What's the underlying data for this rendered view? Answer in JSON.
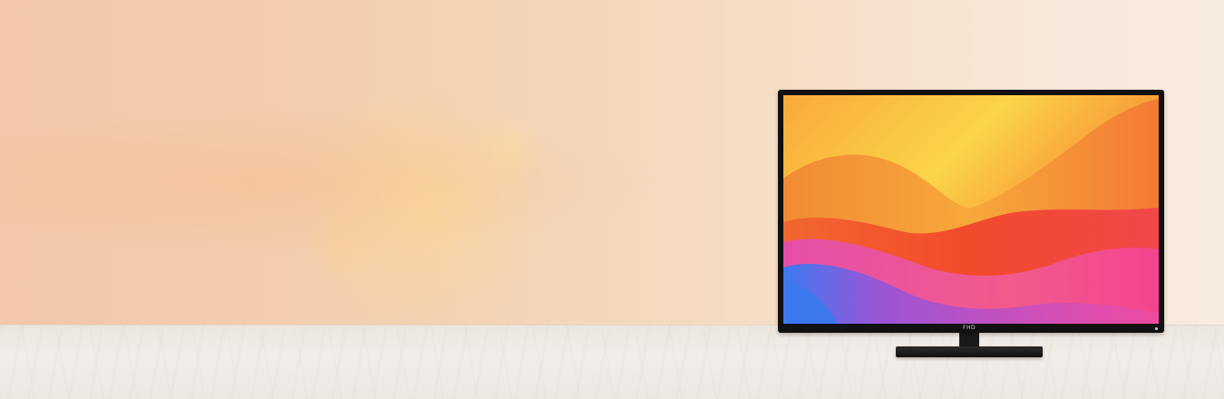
{
  "banner": {
    "tv_brand_mark": "FHD"
  },
  "colors": {
    "wall_warm": "#f3c7a8",
    "wall_light": "#f8ebe0",
    "table_surface": "#ede8e2",
    "tv_bezel": "#111111",
    "screen_yellow": "#fbcf3e",
    "screen_orange": "#f6823a",
    "screen_red": "#f13f2c",
    "screen_pink": "#ee4fa0",
    "screen_purple": "#b25bd4",
    "screen_blue": "#3f76e8"
  },
  "icons": {
    "power_led": "power-indicator-icon"
  }
}
